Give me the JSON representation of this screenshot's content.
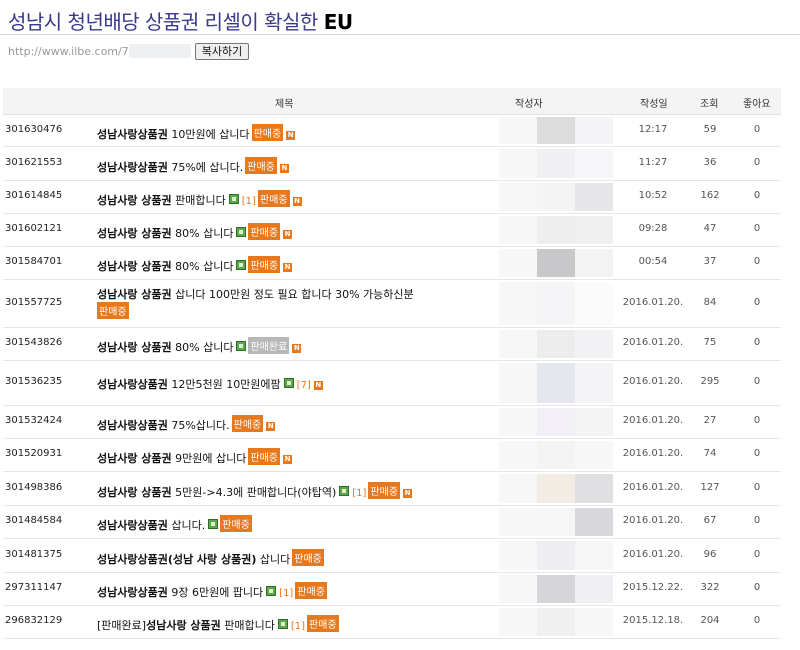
{
  "page": {
    "title_main": "성남시 청년배당 상품권 리셀이 확실한 ",
    "title_bold": "EU",
    "url": "http://www.ilbe.com/7",
    "copy_button": "복사하기"
  },
  "table": {
    "headers": {
      "subject": "제목",
      "author": "작성자",
      "date": "작성일",
      "views": "조회",
      "likes": "좋아요"
    },
    "rows": [
      {
        "num": "301630476",
        "pre": "",
        "bold": "성남사랑상품권",
        "text": " 10만원에 삽니다",
        "img": false,
        "count": "",
        "badge": "판매중",
        "badge_done": false,
        "new": true,
        "date": "12:17",
        "views": "59",
        "likes": "0"
      },
      {
        "num": "301621553",
        "pre": "",
        "bold": "성남사랑상품권",
        "text": " 75%에 삽니다.",
        "img": false,
        "count": "",
        "badge": "판매중",
        "badge_done": false,
        "new": true,
        "date": "11:27",
        "views": "36",
        "likes": "0"
      },
      {
        "num": "301614845",
        "pre": "",
        "bold": "성남사랑 상품권",
        "text": " 판매합니다",
        "img": true,
        "count": "[1]",
        "badge": "판매중",
        "badge_done": false,
        "new": true,
        "date": "10:52",
        "views": "162",
        "likes": "0"
      },
      {
        "num": "301602121",
        "pre": "",
        "bold": "성남사랑 상품권",
        "text": " 80% 삽니다",
        "img": true,
        "count": "",
        "badge": "판매중",
        "badge_done": false,
        "new": true,
        "date": "09:28",
        "views": "47",
        "likes": "0"
      },
      {
        "num": "301584701",
        "pre": "",
        "bold": "성남사랑 상품권",
        "text": " 80% 삽니다",
        "img": true,
        "count": "",
        "badge": "판매중",
        "badge_done": false,
        "new": true,
        "date": "00:54",
        "views": "37",
        "likes": "0"
      },
      {
        "num": "301557725",
        "pre": "",
        "bold": "성남사랑 상품권",
        "text": " 삽니다 100만원 정도 필요 합니다 30% 가능하신분",
        "img": false,
        "count": "",
        "badge": "판매중",
        "badge_done": false,
        "new": false,
        "two_line": true,
        "date": "2016.01.20.",
        "views": "84",
        "likes": "0"
      },
      {
        "num": "301543826",
        "pre": "",
        "bold": "성남사랑 상품권",
        "text": " 80% 삽니다",
        "img": true,
        "count": "",
        "badge": "판매완료",
        "badge_done": true,
        "new": true,
        "date": "2016.01.20.",
        "views": "75",
        "likes": "0"
      },
      {
        "num": "301536235",
        "pre": "",
        "bold": "성남사랑상품권",
        "text": " 12만5천원 10만원에팜",
        "img": true,
        "count": "[7]",
        "badge": "",
        "badge_done": false,
        "new": true,
        "date": "2016.01.20.",
        "views": "295",
        "likes": "0"
      },
      {
        "num": "301532424",
        "pre": "",
        "bold": "성남사랑상품권",
        "text": " 75%삽니다.",
        "img": false,
        "count": "",
        "badge": "판매중",
        "badge_done": false,
        "new": true,
        "date": "2016.01.20.",
        "views": "27",
        "likes": "0"
      },
      {
        "num": "301520931",
        "pre": "",
        "bold": "성남사랑 상품권",
        "text": " 9만원에 삽니다",
        "img": false,
        "count": "",
        "badge": "판매중",
        "badge_done": false,
        "new": true,
        "date": "2016.01.20.",
        "views": "74",
        "likes": "0"
      },
      {
        "num": "301498386",
        "pre": "",
        "bold": "성남사랑 상품권",
        "text": " 5만원->4.3에 판매합니다(야탑역)",
        "img": true,
        "count": "[1]",
        "badge": "판매중",
        "badge_done": false,
        "new": true,
        "date": "2016.01.20.",
        "views": "127",
        "likes": "0"
      },
      {
        "num": "301484584",
        "pre": "",
        "bold": "성남사랑상품권",
        "text": " 삽니다.",
        "img": true,
        "count": "",
        "badge": "판매중",
        "badge_done": false,
        "new": false,
        "date": "2016.01.20.",
        "views": "67",
        "likes": "0"
      },
      {
        "num": "301481375",
        "pre": "",
        "bold": "성남사랑상품권(성남 사랑 상품권)",
        "text": " 삽니다",
        "img": false,
        "count": "",
        "badge": "판매중",
        "badge_done": false,
        "new": false,
        "date": "2016.01.20.",
        "views": "96",
        "likes": "0"
      },
      {
        "num": "297311147",
        "pre": "",
        "bold": "성남사랑상품권",
        "text": " 9장 6만원에 팝니다",
        "img": true,
        "count": "[1]",
        "badge": "판매중",
        "badge_done": false,
        "new": false,
        "date": "2015.12.22.",
        "views": "322",
        "likes": "0"
      },
      {
        "num": "296832129",
        "pre": "[판매완료]",
        "bold": "성남사랑 상품권",
        "text": " 판매합니다",
        "img": true,
        "count": "[1]",
        "badge": "판매중",
        "badge_done": false,
        "new": false,
        "date": "2015.12.18.",
        "views": "204",
        "likes": "0"
      }
    ]
  },
  "colors": {
    "badge": "#e8781c",
    "badge_done": "#b8b8b8",
    "title": "#3a3a8c"
  }
}
